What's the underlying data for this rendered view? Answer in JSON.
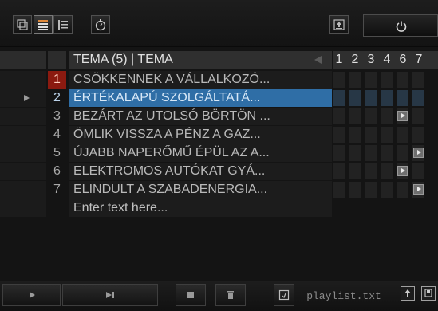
{
  "toolbar": {
    "buttons": [
      "copy-icon",
      "list-view-icon",
      "tree-view-icon",
      "stopwatch-icon",
      "export-icon",
      "power-icon"
    ]
  },
  "header": {
    "title": "TEMA (5) | TEMA",
    "columns": [
      "1",
      "2",
      "3",
      "4",
      "6",
      "7"
    ]
  },
  "rows": [
    {
      "num": "1",
      "title": "CSÖKKENNEK A VÁLLALKOZÓ...",
      "flags": []
    },
    {
      "num": "2",
      "title": "ÉRTÉKALAPÚ SZOLGÁLTATÁ...",
      "flags": [],
      "selected": true
    },
    {
      "num": "3",
      "title": "BEZÁRT AZ UTOLSÓ BÖRTÖN ...",
      "flags": [
        "4"
      ]
    },
    {
      "num": "4",
      "title": "ÖMLIK VISSZA A PÉNZ A GAZ...",
      "flags": []
    },
    {
      "num": "5",
      "title": "ÚJABB NAPERŐMŰ ÉPÜL AZ A...",
      "flags": [
        "6"
      ]
    },
    {
      "num": "6",
      "title": "ELEKTROMOS AUTÓKAT GYÁ...",
      "flags": [
        "4"
      ]
    },
    {
      "num": "7",
      "title": "ELINDULT A SZABADENERGIA...",
      "flags": [
        "6"
      ]
    }
  ],
  "placeholder": "Enter text here...",
  "bottom": {
    "playlist_file": "playlist.txt"
  },
  "colors": {
    "selection": "#2f6ea6",
    "active_number": "#8b1a10"
  }
}
